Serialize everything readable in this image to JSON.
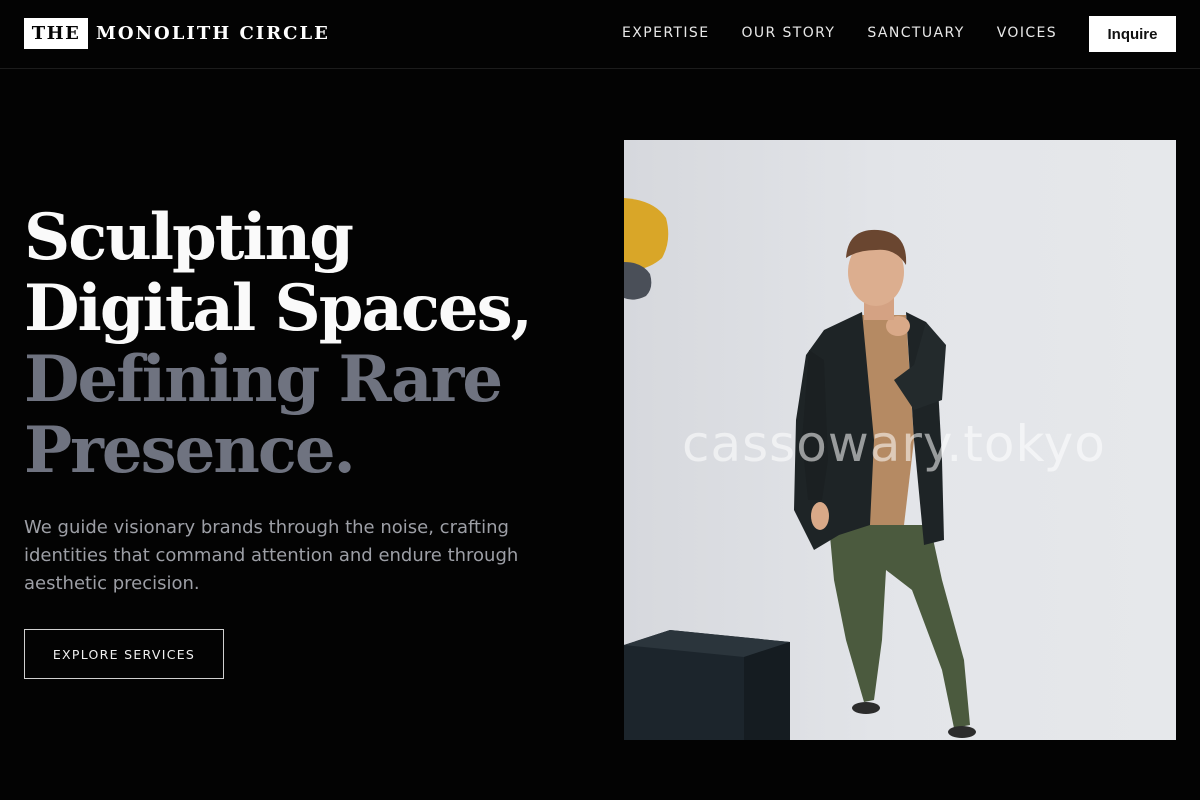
{
  "header": {
    "logo_box": "THE",
    "logo_text": "MONOLITH CIRCLE",
    "nav": [
      "EXPERTISE",
      "OUR STORY",
      "SANCTUARY",
      "VOICES"
    ],
    "cta": "Inquire"
  },
  "hero": {
    "headline": {
      "line1": "Sculpting",
      "line2": "Digital Spaces,",
      "line3": "Defining Rare",
      "line4": "Presence."
    },
    "subtext": "We guide visionary brands through the noise, crafting identities that command attention and endure through aesthetic precision.",
    "button": "EXPLORE SERVICES"
  },
  "photo": {
    "watermark": "cassowary.tokyo"
  },
  "colors": {
    "background": "#030303",
    "headline_white": "#fafafa",
    "headline_grey": "#6f7380",
    "subtext": "#9d9fa6"
  }
}
